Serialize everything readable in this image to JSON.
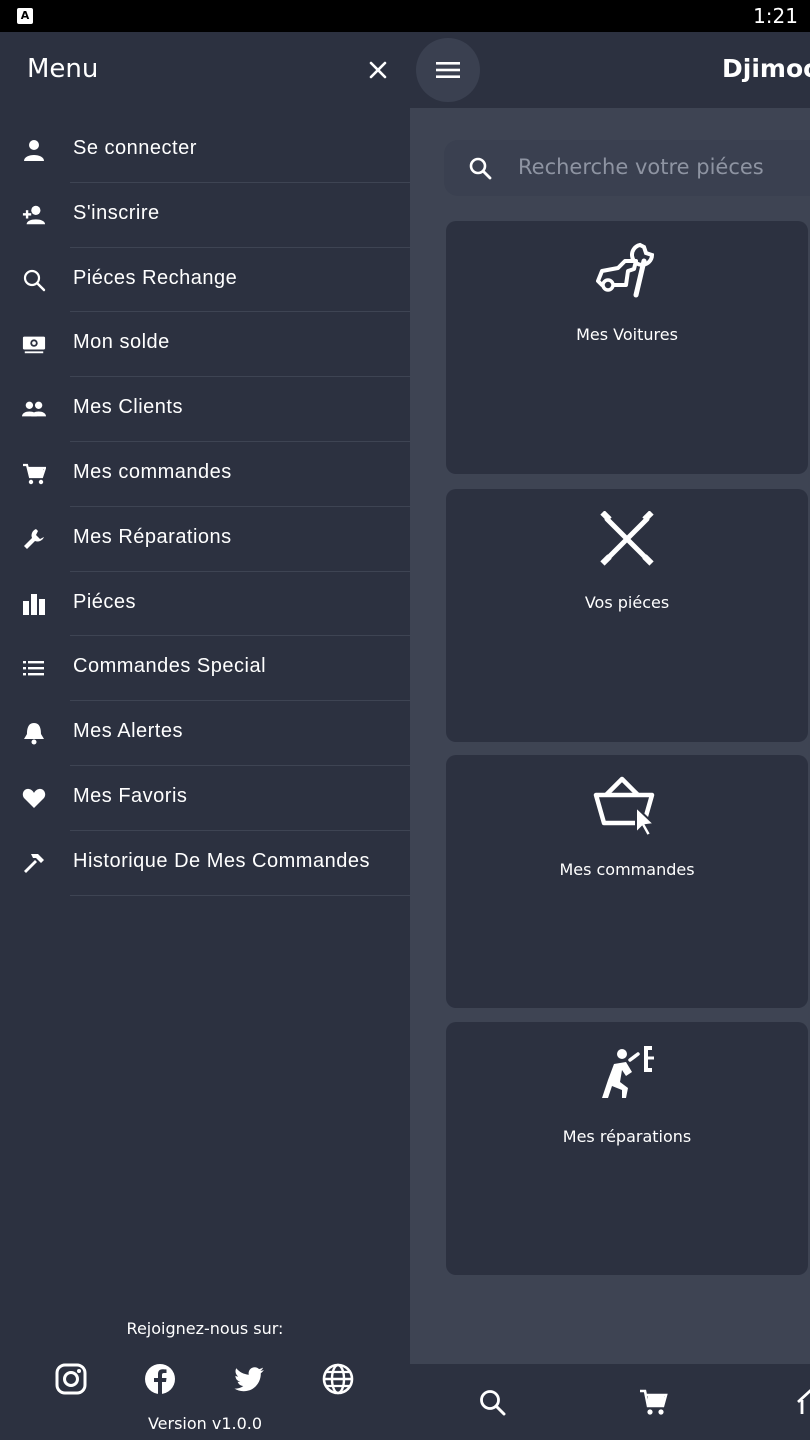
{
  "status_bar": {
    "time": "1:21",
    "app_badge": "A"
  },
  "app": {
    "title": "Djimoo"
  },
  "search": {
    "placeholder": "Recherche votre piéces"
  },
  "cards": [
    {
      "label": "Mes Voitures",
      "icon": "car-wrench-icon"
    },
    {
      "label": "Vos piéces",
      "icon": "crossed-wrenches-icon"
    },
    {
      "label": "Mes commandes",
      "icon": "basket-cursor-icon"
    },
    {
      "label": "Mes réparations",
      "icon": "mechanic-icon"
    }
  ],
  "drawer": {
    "title": "Menu",
    "items": [
      {
        "label": "Se connecter",
        "icon": "person-icon"
      },
      {
        "label": "S'inscrire",
        "icon": "person-add-icon"
      },
      {
        "label": "Piéces Rechange",
        "icon": "search-icon"
      },
      {
        "label": "Mon solde",
        "icon": "money-icon"
      },
      {
        "label": "Mes Clients",
        "icon": "people-icon"
      },
      {
        "label": "Mes commandes",
        "icon": "cart-icon"
      },
      {
        "label": "Mes Réparations",
        "icon": "wrench-icon"
      },
      {
        "label": "Piéces",
        "icon": "bars-icon"
      },
      {
        "label": "Commandes Special",
        "icon": "list-icon"
      },
      {
        "label": "Mes Alertes",
        "icon": "bell-icon"
      },
      {
        "label": "Mes Favoris",
        "icon": "heart-icon"
      },
      {
        "label": "Historique De Mes Commandes",
        "icon": "hammer-icon"
      }
    ],
    "join_text": "Rejoignez-nous sur:",
    "social": [
      "instagram-icon",
      "facebook-icon",
      "twitter-icon",
      "web-icon"
    ],
    "version": "Version v1.0.0"
  },
  "colors": {
    "background": "#3e4453",
    "surface": "#2c3140",
    "text": "#ffffff"
  }
}
